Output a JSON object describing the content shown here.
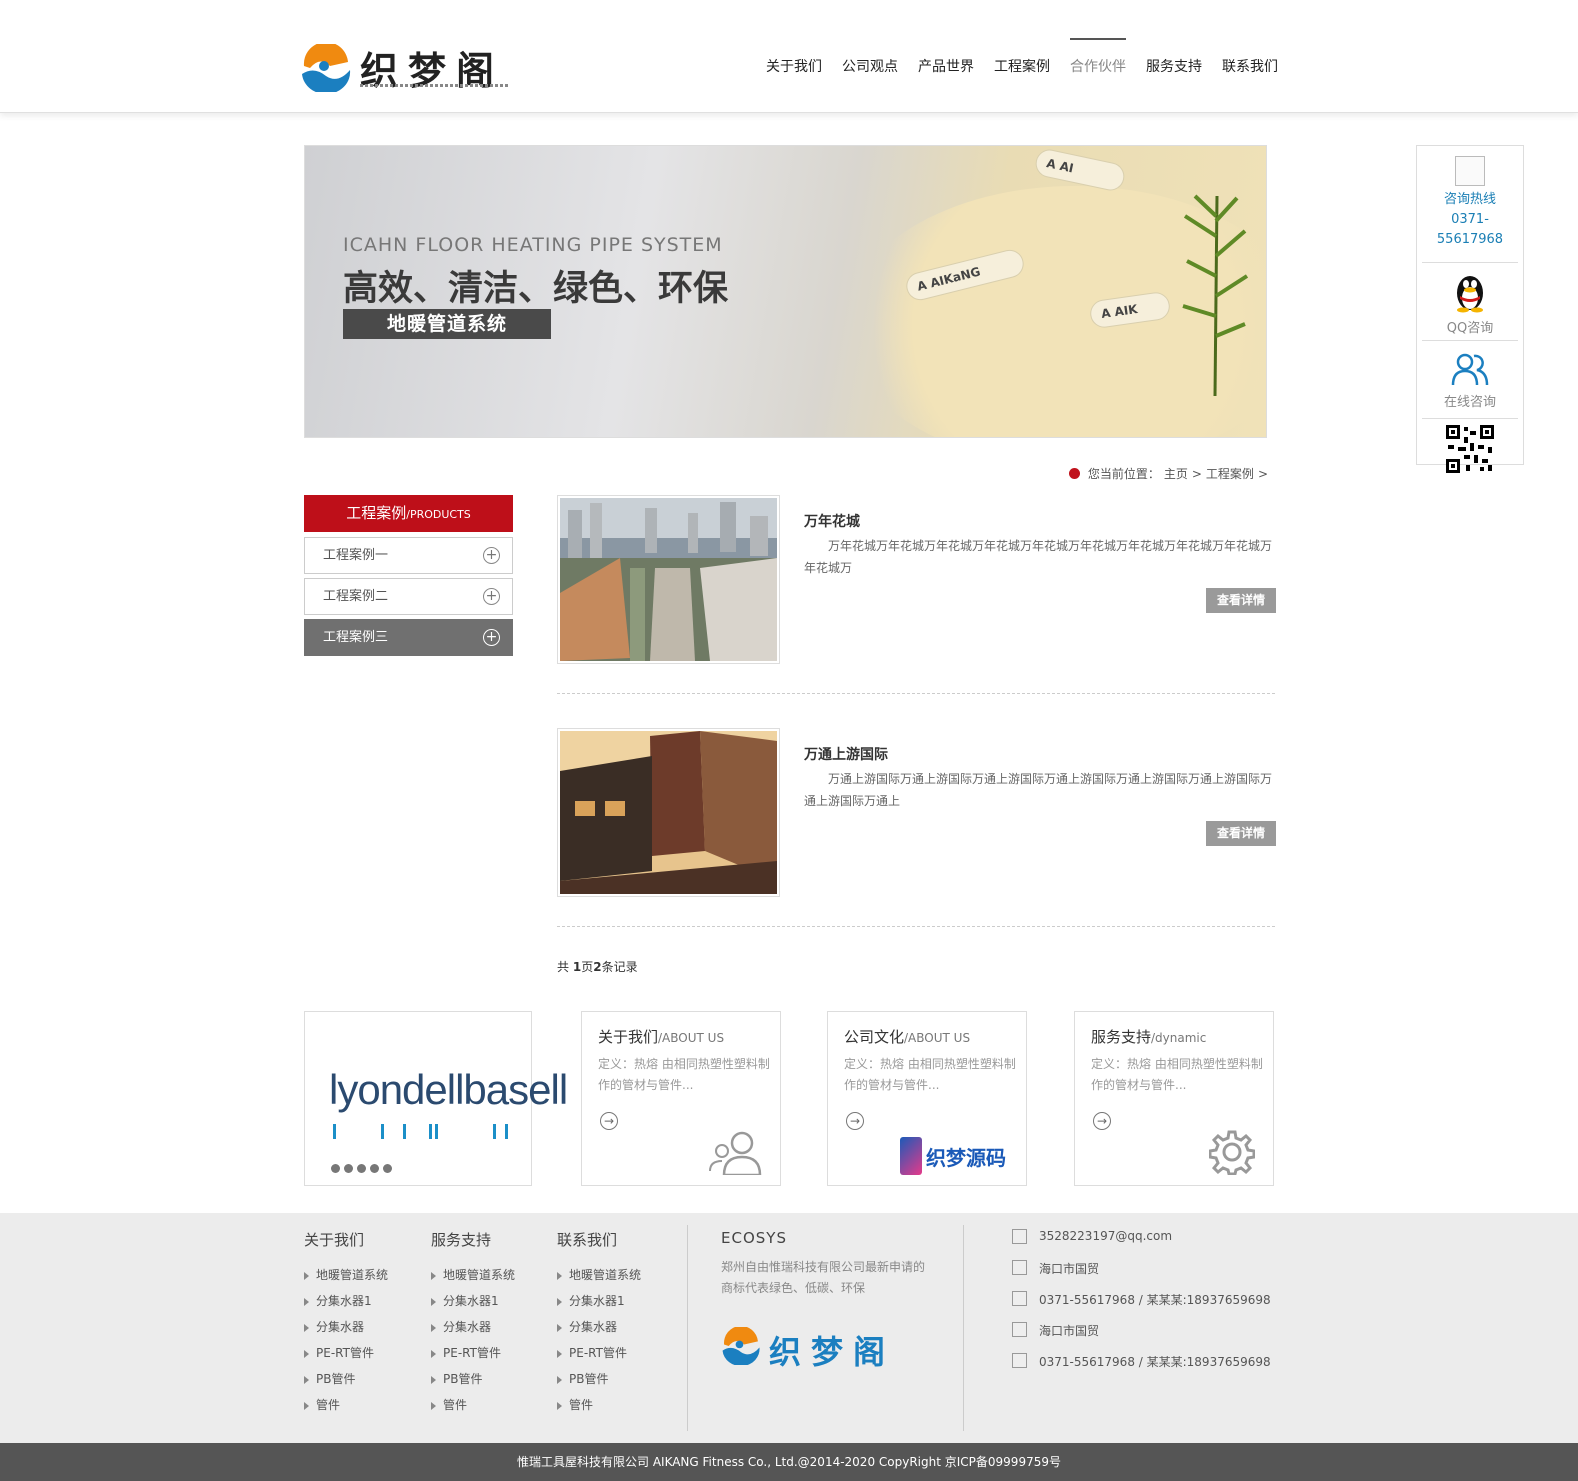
{
  "header": {
    "logo_text": "织梦阁",
    "nav": [
      {
        "label": "关于我们",
        "active": false
      },
      {
        "label": "公司观点",
        "active": false
      },
      {
        "label": "产品世界",
        "active": false
      },
      {
        "label": "工程案例",
        "active": false
      },
      {
        "label": "合作伙伴",
        "active": true
      },
      {
        "label": "服务支持",
        "active": false
      },
      {
        "label": "联系我们",
        "active": false
      }
    ]
  },
  "banner": {
    "en": "ICAHN FLOOR HEATING PIPE SYSTEM",
    "cn": "高效、清洁、绿色、环保",
    "tag": "地暖管道系统",
    "pipe1": "A AIKaNG",
    "pipe2": "A AI",
    "pipe3": "A AIK"
  },
  "side_float": {
    "hotline_label": "咨询热线",
    "hotline_number_1": "0371-",
    "hotline_number_2": "55617968",
    "qq_label": "QQ咨询",
    "online_label": "在线咨询"
  },
  "breadcrumb": {
    "prefix": "您当前位置：",
    "home": "主页",
    "sep1": ">",
    "current": "工程案例",
    "sep2": ">"
  },
  "left_menu": {
    "title": "工程案例",
    "title_en": "/PRODUCTS",
    "items": [
      {
        "label": "工程案例一",
        "active": false
      },
      {
        "label": "工程案例二",
        "active": false
      },
      {
        "label": "工程案例三",
        "active": true
      }
    ]
  },
  "cases": [
    {
      "title": "万年花城",
      "desc": "万年花城万年花城万年花城万年花城万年花城万年花城万年花城万年花城万年花城万年花城万",
      "button": "查看详情"
    },
    {
      "title": "万通上游国际",
      "desc": "万通上游国际万通上游国际万通上游国际万通上游国际万通上游国际万通上游国际万通上游国际万通上",
      "button": "查看详情"
    }
  ],
  "pager": {
    "prefix": "共 ",
    "pages": "1",
    "mid": "页",
    "records": "2",
    "suffix": "条记录"
  },
  "partner": {
    "name": "lyondellbasell"
  },
  "info_boxes": [
    {
      "title": "关于我们",
      "title_en": "/ABOUT US",
      "text": "定义：热熔  由相同热塑性塑料制作的管材与管件...",
      "icon": "users-icon"
    },
    {
      "title": "公司文化",
      "title_en": "/ABOUT US",
      "text": "定义：热熔  由相同热塑性塑料制作的管材与管件...",
      "icon": "dedecode-logo",
      "logo_text": "织梦源码"
    },
    {
      "title": "服务支持",
      "title_en": "/dynamic",
      "text": "定义：热熔  由相同热塑性塑料制作的管材与管件...",
      "icon": "gear-icon"
    }
  ],
  "footer": {
    "col1": {
      "title": "关于我们",
      "items": [
        "地暖管道系统",
        "分集水器1",
        "分集水器",
        "PE-RT管件",
        "PB管件",
        "管件"
      ]
    },
    "col2": {
      "title": "服务支持",
      "items": [
        "地暖管道系统",
        "分集水器1",
        "分集水器",
        "PE-RT管件",
        "PB管件",
        "管件"
      ]
    },
    "col3": {
      "title": "联系我们",
      "items": [
        "地暖管道系统",
        "分集水器1",
        "分集水器",
        "PE-RT管件",
        "PB管件",
        "管件"
      ]
    },
    "eco_title": "ECOSYS",
    "eco_text": "郑州自由惟瑞科技有限公司最新申请的商标代表绿色、低碳、环保",
    "eco_logo": "织梦阁",
    "contacts": [
      "3528223197@qq.com",
      "海口市国贸",
      "0371-55617968 / 某某某:18937659698",
      "海口市国贸",
      "0371-55617968 / 某某某:18937659698"
    ],
    "copyright": "惟瑞工具屋科技有限公司 AIKANG Fitness Co., Ltd.@2014-2020 CopyRight 京ICP备09999759号"
  }
}
